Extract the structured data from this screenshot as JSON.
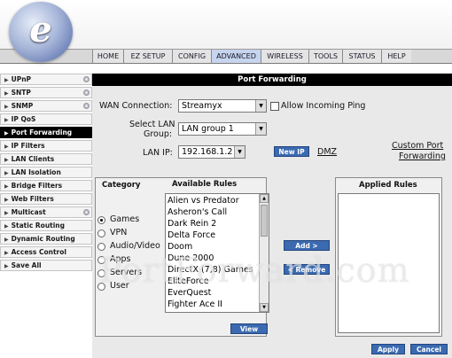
{
  "brand": {
    "logo_letter": "e"
  },
  "nav": {
    "items": [
      {
        "label": "HOME"
      },
      {
        "label": "EZ SETUP"
      },
      {
        "label": "CONFIG"
      },
      {
        "label": "ADVANCED",
        "active": true
      },
      {
        "label": "WIRELESS"
      },
      {
        "label": "TOOLS"
      },
      {
        "label": "STATUS"
      },
      {
        "label": "HELP"
      }
    ]
  },
  "sidebar": {
    "items": [
      {
        "label": "UPnP"
      },
      {
        "label": "SNTP"
      },
      {
        "label": "SNMP"
      },
      {
        "label": "IP QoS"
      },
      {
        "label": "Port Forwarding",
        "active": true
      },
      {
        "label": "IP Filters"
      },
      {
        "label": "LAN Clients"
      },
      {
        "label": "LAN Isolation"
      },
      {
        "label": "Bridge Filters"
      },
      {
        "label": "Web Filters"
      },
      {
        "label": "Multicast"
      },
      {
        "label": "Static Routing"
      },
      {
        "label": "Dynamic Routing"
      },
      {
        "label": "Access Control"
      },
      {
        "label": "Save All"
      }
    ]
  },
  "page": {
    "title": "Port Forwarding"
  },
  "form": {
    "wan_label": "WAN Connection:",
    "wan_value": "Streamyx",
    "allow_ping_label": "Allow Incoming Ping",
    "lan_group_label_1": "Select LAN",
    "lan_group_label_2": "Group:",
    "lan_group_value": "LAN group 1",
    "lan_ip_label": "LAN IP:",
    "lan_ip_value": "192.168.1.2",
    "new_ip_button": "New IP",
    "dmz_link": "DMZ",
    "custom_link_1": "Custom Port",
    "custom_link_2": "Forwarding"
  },
  "rules": {
    "category_header": "Category",
    "available_header": "Available Rules",
    "applied_header": "Applied Rules",
    "categories": [
      {
        "label": "Games",
        "selected": true
      },
      {
        "label": "VPN"
      },
      {
        "label": "Audio/Video"
      },
      {
        "label": "Apps"
      },
      {
        "label": "Servers"
      },
      {
        "label": "User"
      }
    ],
    "available": [
      "Alien vs Predator",
      "Asheron's Call",
      "Dark Rein 2",
      "Delta Force",
      "Doom",
      "Dune 2000",
      "DirectX (7,8) Games",
      "EliteForce",
      "EverQuest",
      "Fighter Ace II"
    ],
    "add_button": "Add >",
    "remove_button": "< Remove",
    "view_button": "View"
  },
  "footer": {
    "apply_button": "Apply",
    "cancel_button": "Cancel"
  },
  "watermark": "PortForward.com"
}
